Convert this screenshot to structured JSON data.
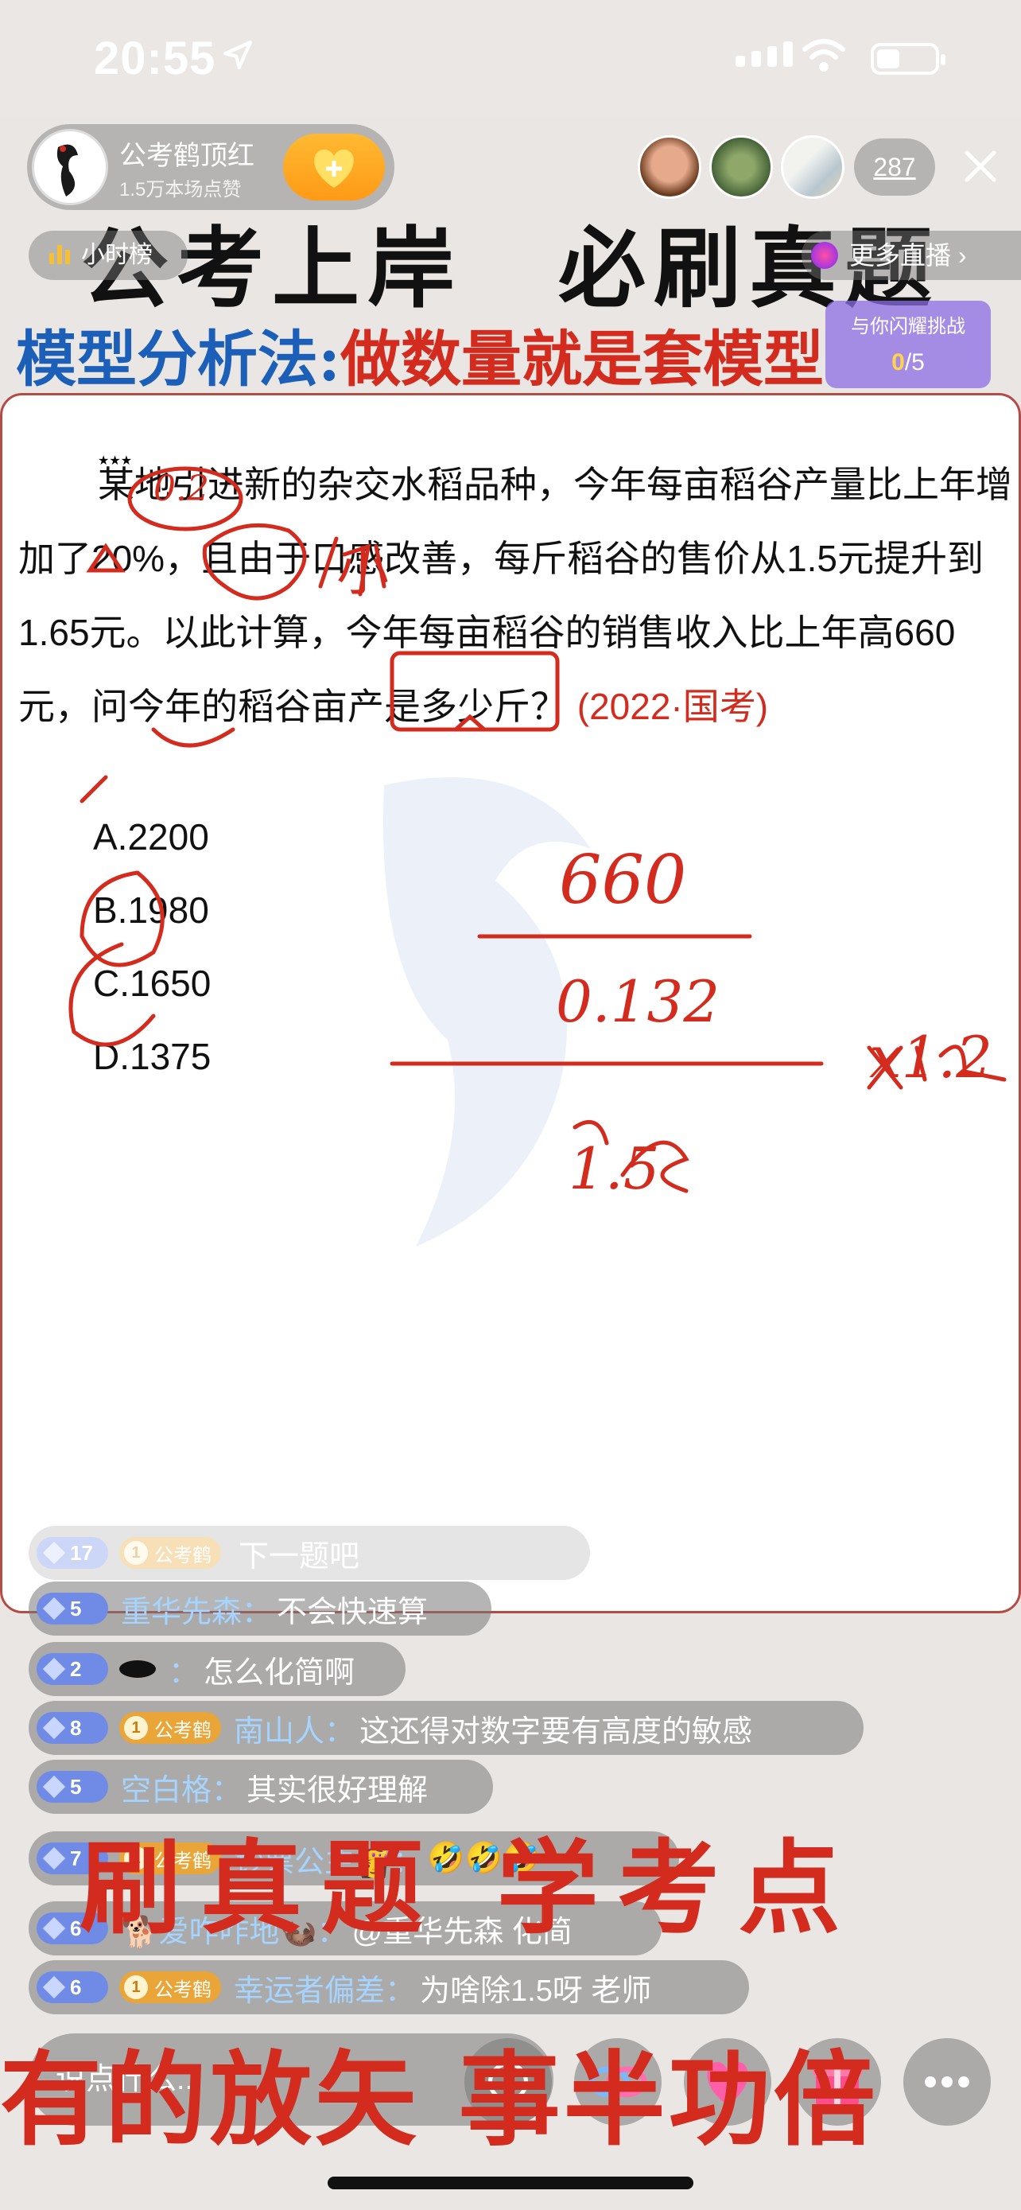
{
  "status_bar": {
    "time": "20:55"
  },
  "host": {
    "name": "公考鹤顶红",
    "likes": "1.5万本场点赞"
  },
  "viewer_count": "287",
  "hourly_rank": "小时榜",
  "more_live": "更多直播",
  "title": "公考上岸　必刷真题",
  "subtitle": {
    "part1": "模型分析法:",
    "part2": "做数量就是套模型"
  },
  "challenge": {
    "label": "与你闪耀挑战",
    "progress_current": "0",
    "progress_total": "/5"
  },
  "question": {
    "text": "某地引进新的杂交水稻品种，今年每亩稻谷产量比上年增加了20%，且由于口感改善，每斤稻谷的售价从1.5元提升到1.65元。以此计算，今年每亩稻谷的销售收入比上年高660元，问今年的稻谷亩产是多少斤？",
    "source": "(2022·国考)",
    "stars": "★★★"
  },
  "options": [
    "A.2200",
    "B.1980",
    "C.1650",
    "D.1375"
  ],
  "handwriting": [
    "0.2",
    "小",
    "660",
    "0.132",
    "1.5",
    "x1.2"
  ],
  "chat": [
    {
      "level": "17",
      "fan": "公考鹤",
      "user": "",
      "text": "下一题吧"
    },
    {
      "level": "5",
      "fan": "",
      "user": "重华先森：",
      "text": "不会快速算"
    },
    {
      "level": "2",
      "fan": "",
      "user": "：",
      "text": "怎么化简啊"
    },
    {
      "level": "8",
      "fan": "公考鹤",
      "user": "南山人：",
      "text": "这还得对数字要有高度的敏感"
    },
    {
      "level": "5",
      "fan": "",
      "user": "空白格：",
      "text": "其实很好理解"
    },
    {
      "level": "7",
      "fan": "公考鹤",
      "user": "钞票公主👸：",
      "text": "🤣🤣🤣"
    },
    {
      "level": "6",
      "fan": "",
      "user": "🐕爱咋咋地🦦：",
      "text": "@重华先森 化简"
    },
    {
      "level": "6",
      "fan": "公考鹤",
      "user": "幸运者偏差：",
      "text": "为啥除1.5呀 老师"
    }
  ],
  "overlay": {
    "line1": "刷真题 学考点",
    "line2": "有的放矢 事半功倍"
  },
  "input_placeholder": "说点什么...",
  "icons": [
    "location-arrow-icon",
    "signal-icon",
    "wifi-icon",
    "battery-icon",
    "close-icon",
    "emoji-icon",
    "link-icon",
    "heart-gift-icon",
    "gift-icon",
    "more-icon"
  ],
  "colors": {
    "accent_red": "#d32b1e",
    "accent_blue": "#1c5fb8",
    "star": "#f6c126"
  }
}
